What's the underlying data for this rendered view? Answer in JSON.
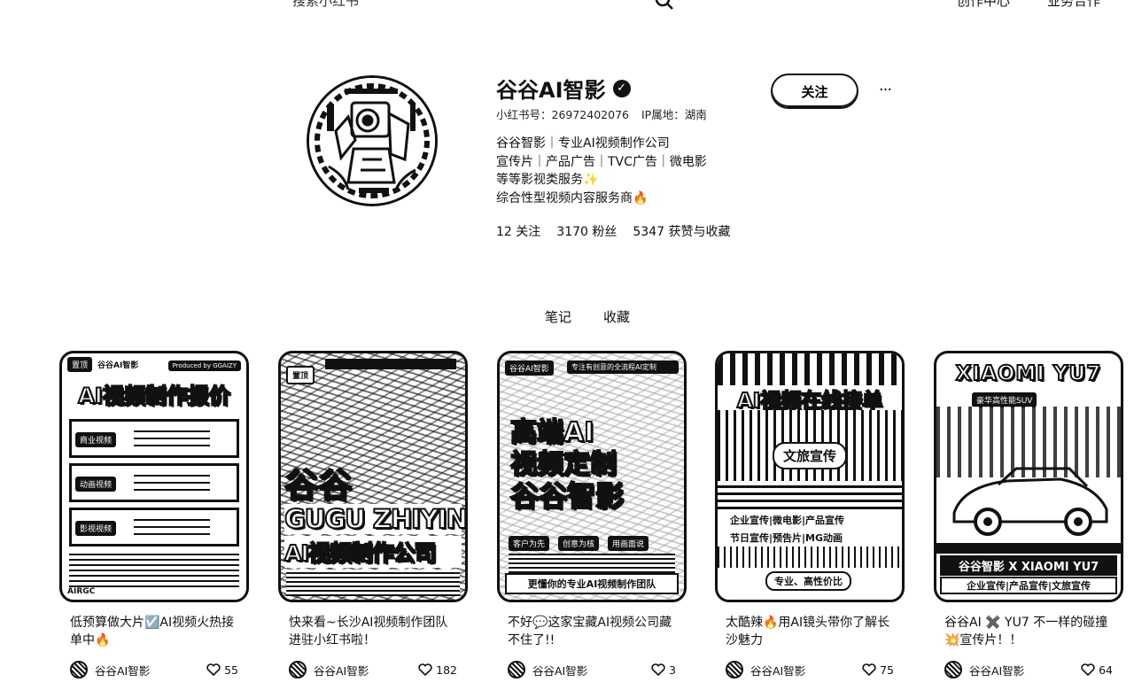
{
  "header": {
    "search_placeholder": "搜索小红书",
    "link_creator": "创作中心",
    "link_business": "业务合作"
  },
  "profile": {
    "name": "谷谷AI智影",
    "xhs_id": "小红书号：26972402076",
    "ip": "IP属地：湖南",
    "bio": [
      "谷谷智影｜专业AI视频制作公司",
      "宣传片｜产品广告｜TVC广告｜微电影",
      "等等影视类服务✨",
      "综合性型视频内容服务商🔥"
    ],
    "following": "12",
    "following_label": "关注",
    "followers": "3170",
    "followers_label": "粉丝",
    "likes": "5347",
    "likes_label": "获赞与收藏",
    "follow_button": "关注",
    "more": "···"
  },
  "tabs": [
    "笔记",
    "收藏"
  ],
  "notes": [
    {
      "title": "低预算做大片☑️AI视频火热接单中🔥",
      "author": "谷谷AI智影",
      "likes": "55",
      "cover": {
        "pin": "置顶",
        "brand": "谷谷AI智影",
        "producer": "Produced by GGAIZY",
        "headline": "AI视频制作报价",
        "rows": [
          "商业视频",
          "动画视频",
          "影视视频"
        ],
        "footer": "AIRGC"
      }
    },
    {
      "title": "快来看~长沙AI视频制作团队进驻小红书啦！",
      "author": "谷谷AI智影",
      "likes": "182",
      "cover": {
        "pin": "置顶",
        "line1": "谷谷",
        "line2": "GUGU ZHIYIN",
        "line3": "AI视频制作公司"
      }
    },
    {
      "title": "不好💬这家宝藏AI视频公司藏不住了!!",
      "author": "谷谷AI智影",
      "likes": "3",
      "cover": {
        "brand": "谷谷AI智影",
        "tagline": "专注有创意的全流程AI定制",
        "line1": "高端AI",
        "line2": "视频定制",
        "line3": "谷谷智影",
        "tags": [
          "客户为先",
          "创意为核",
          "用画面说"
        ],
        "bottom": "更懂你的专业AI视频制作团队"
      }
    },
    {
      "title": "太酷辣🔥用AI镜头带你了解长沙魅力",
      "author": "谷谷AI智影",
      "likes": "75",
      "cover": {
        "headline": "AI视频在线接单",
        "center": "文旅宣传",
        "row1": "企业宣传|微电影|产品宣传",
        "row2": "节日宣传|预告片|MG动画",
        "bottom": "专业、高性价比"
      }
    },
    {
      "title": "谷谷AI ✖️ YU7 不一样的碰撞💥宣传片！！",
      "author": "谷谷AI智影",
      "likes": "64",
      "cover": {
        "headline": "XIAOMI YU7",
        "sub": "豪华高性能SUV",
        "line": "谷谷智影 X XIAOMI YU7",
        "bottom": "企业宣传|产品宣传|文旅宣传"
      }
    }
  ]
}
